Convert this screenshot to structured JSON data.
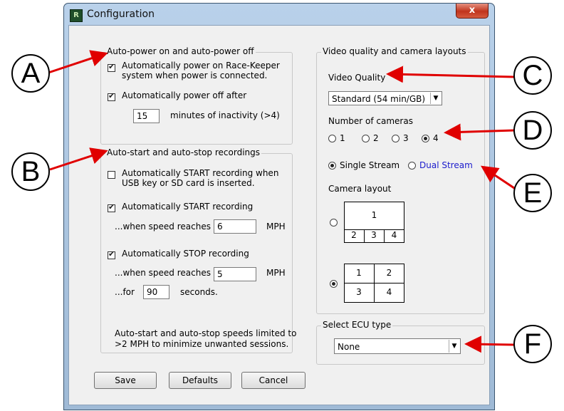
{
  "window": {
    "title": "Configuration",
    "close_label": "x",
    "app_icon_text": "R"
  },
  "auto_power": {
    "title": "Auto-power on and auto-power off",
    "power_on_line1": "Automatically power on Race-Keeper",
    "power_on_line2": "system when power is connected.",
    "power_off_label": "Automatically power off after",
    "minutes_value": "15",
    "minutes_suffix": "minutes of inactivity (>4)"
  },
  "auto_record": {
    "title": "Auto-start and auto-stop recordings",
    "start_usb_line1": "Automatically START recording when",
    "start_usb_line2": "USB key or SD card is inserted.",
    "start_speed_label": "Automatically START recording",
    "start_speed_prefix": "...when speed reaches",
    "start_speed_value": "6",
    "start_speed_unit": "MPH",
    "stop_label": "Automatically STOP recording",
    "stop_speed_prefix": "...when speed reaches",
    "stop_speed_value": "5",
    "stop_speed_unit": "MPH",
    "for_prefix": "...for",
    "for_value": "90",
    "for_unit": "seconds.",
    "note_line1": "Auto-start and auto-stop speeds limited to",
    "note_line2": ">2 MPH to minimize unwanted sessions."
  },
  "video": {
    "title": "Video quality and camera layouts",
    "quality_label": "Video Quality",
    "quality_value": "Standard (54 min/GB)",
    "cameras_label": "Number of cameras",
    "camera_options": [
      "1",
      "2",
      "3",
      "4"
    ],
    "single_stream": "Single Stream",
    "dual_stream": "Dual Stream",
    "layout_label": "Camera layout",
    "layout1": [
      "1",
      "2",
      "3",
      "4"
    ],
    "layout2": [
      "1",
      "2",
      "3",
      "4"
    ]
  },
  "ecu": {
    "title": "Select ECU type",
    "value": "None"
  },
  "buttons": {
    "save": "Save",
    "defaults": "Defaults",
    "cancel": "Cancel"
  },
  "callouts": [
    "A",
    "B",
    "C",
    "D",
    "E",
    "F"
  ],
  "colors": {
    "arrow": "#e00000",
    "link": "#1a1acc"
  },
  "icons": {
    "dropdown": "▼"
  }
}
